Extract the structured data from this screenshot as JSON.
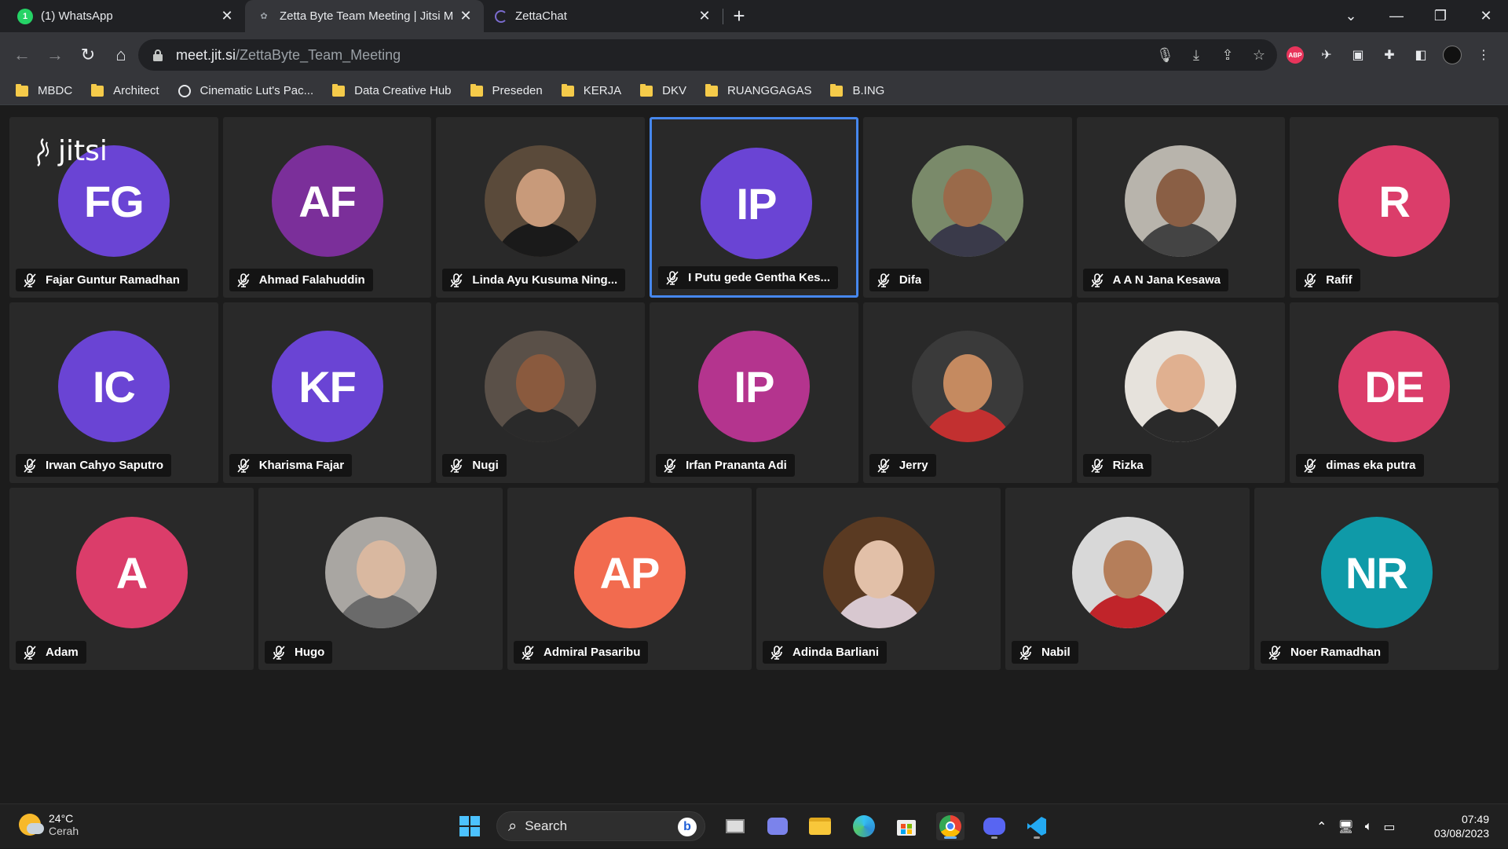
{
  "browser": {
    "tabs": [
      {
        "title": "(1) WhatsApp",
        "icon": "whatsapp-icon"
      },
      {
        "title": "Zetta Byte Team Meeting | Jitsi M",
        "icon": "jitsi-icon"
      },
      {
        "title": "ZettaChat",
        "icon": "loading-icon"
      }
    ],
    "url_host": "meet.jit.si",
    "url_path": "/ZettaByte_Team_Meeting",
    "abp_label": "ABP",
    "bookmarks": [
      {
        "label": "MBDC",
        "icon": "folder-icon"
      },
      {
        "label": "Architect",
        "icon": "folder-icon"
      },
      {
        "label": "Cinematic Lut's Pac...",
        "icon": "globe-icon"
      },
      {
        "label": "Data Creative Hub",
        "icon": "folder-icon"
      },
      {
        "label": "Preseden",
        "icon": "folder-icon"
      },
      {
        "label": "KERJA",
        "icon": "folder-icon"
      },
      {
        "label": "DKV",
        "icon": "folder-icon"
      },
      {
        "label": "RUANGGAGAS",
        "icon": "folder-icon"
      },
      {
        "label": "B.ING",
        "icon": "folder-icon"
      }
    ]
  },
  "meeting": {
    "logo_text": "jitsi",
    "row1": [
      {
        "initials": "FG",
        "name": "Fajar Guntur Ramadhan",
        "color": "#6a44d4",
        "photo": false
      },
      {
        "initials": "AF",
        "name": "Ahmad Falahuddin",
        "color": "#7b2f9a",
        "photo": false
      },
      {
        "initials": "",
        "name": "Linda Ayu Kusuma Ning...",
        "color": "#5a4a3a",
        "photo": true,
        "skin": "#c89a7a",
        "cloth": "#1a1a1a"
      },
      {
        "initials": "IP",
        "name": "I Putu gede Gentha Kes...",
        "color": "#6a44d4",
        "photo": false,
        "active": true
      },
      {
        "initials": "",
        "name": "Difa",
        "color": "#7a8a6a",
        "photo": true,
        "skin": "#9a6a4a",
        "cloth": "#3a3a4a"
      },
      {
        "initials": "",
        "name": "A A N Jana Kesawa",
        "color": "#b8b4ac",
        "photo": true,
        "skin": "#8a5f45",
        "cloth": "#444"
      },
      {
        "initials": "R",
        "name": "Rafif",
        "color": "#db3d6a",
        "photo": false
      }
    ],
    "row2": [
      {
        "initials": "IC",
        "name": "Irwan Cahyo Saputro",
        "color": "#6a44d4",
        "photo": false
      },
      {
        "initials": "KF",
        "name": "Kharisma Fajar",
        "color": "#6a44d4",
        "photo": false
      },
      {
        "initials": "",
        "name": "Nugi",
        "color": "#5a5048",
        "photo": true,
        "skin": "#8a5a3e",
        "cloth": "#2a2a2a"
      },
      {
        "initials": "IP",
        "name": "Irfan Prananta Adi",
        "color": "#b4348e",
        "photo": false
      },
      {
        "initials": "",
        "name": "Jerry",
        "color": "#3a3a3a",
        "photo": true,
        "skin": "#c58a60",
        "cloth": "#c23030"
      },
      {
        "initials": "",
        "name": "Rizka",
        "color": "#e6e2dc",
        "photo": true,
        "skin": "#e0b090",
        "cloth": "#2a2a2a"
      },
      {
        "initials": "DE",
        "name": "dimas eka putra",
        "color": "#db3d6a",
        "photo": false
      }
    ],
    "row3": [
      {
        "initials": "A",
        "name": "Adam",
        "color": "#db3d6a",
        "photo": false
      },
      {
        "initials": "",
        "name": "Hugo",
        "color": "#a9a6a2",
        "photo": true,
        "skin": "#d9b8a0",
        "cloth": "#6a6a6a"
      },
      {
        "initials": "AP",
        "name": "Admiral Pasaribu",
        "color": "#f26b4f",
        "photo": false
      },
      {
        "initials": "",
        "name": "Adinda Barliani",
        "color": "#5a3a22",
        "photo": true,
        "skin": "#e2c0a8",
        "cloth": "#d8c8d0"
      },
      {
        "initials": "",
        "name": "Nabil",
        "color": "#d8d8d8",
        "photo": true,
        "skin": "#b57e5a",
        "cloth": "#c0242a"
      },
      {
        "initials": "NR",
        "name": "Noer Ramadhan",
        "color": "#0f9aa8",
        "photo": false
      }
    ]
  },
  "taskbar": {
    "temp": "24°C",
    "condition": "Cerah",
    "search_label": "Search",
    "bing_label": "b",
    "time": "07:49",
    "date": "03/08/2023"
  }
}
